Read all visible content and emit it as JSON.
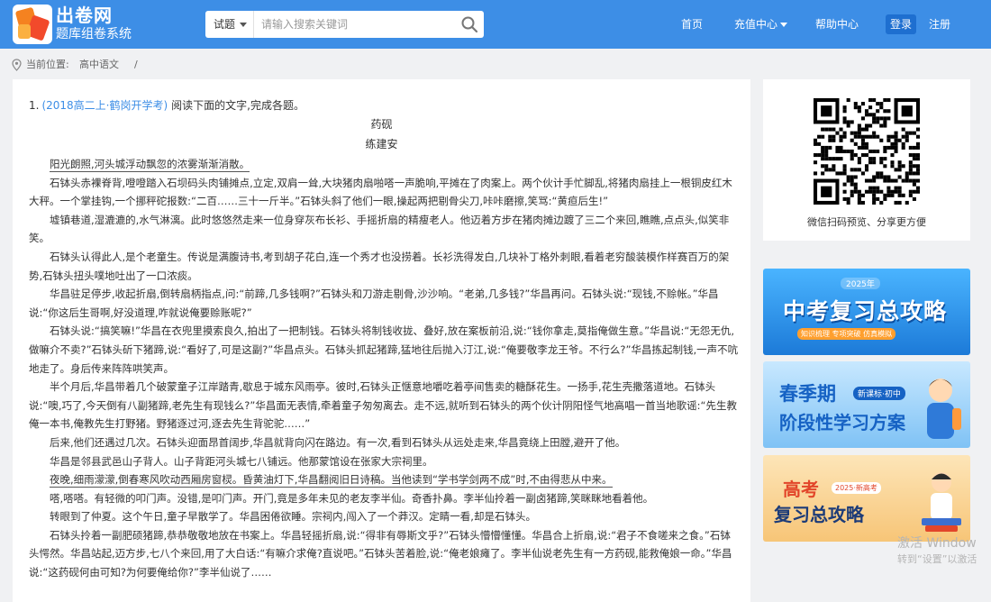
{
  "header": {
    "logo_title": "出卷网",
    "logo_subtitle": "题库组卷系统",
    "search": {
      "type_label": "试题",
      "placeholder": "请输入搜索关键词"
    },
    "nav": {
      "home": "首页",
      "charge": "充值中心",
      "help": "帮助中心",
      "login": "登录",
      "register": "注册"
    }
  },
  "breadcrumb": {
    "label": "当前位置:",
    "item": "高中语文",
    "separator": "/"
  },
  "question": {
    "number": "1.",
    "source": "(2018高二上·鹤岗开学考)",
    "instruction": "阅读下面的文字,完成各题。",
    "title": "药砚",
    "author": "练建安",
    "paragraphs": [
      "阳光朗照,河头城浮动飘忽的浓雾渐渐消散。",
      "石钵头赤裸脊背,噔噔踏入石坝码头肉铺摊点,立定,双肩一耸,大块猪肉扇啪嗒一声脆响,平摊在了肉案上。两个伙计手忙脚乱,将猪肉扇挂上一根铜皮红木大秤。一个掌挂钩,一个挪秤砣报数:“二百……三十一斤半。”石钵头斜了他们一眼,操起两把剔骨尖刀,咔咔磨擦,笑骂:“黄疸后生!”",
      "墟镇巷道,湿漉漉的,水气淋漓。此时悠悠然走来一位身穿灰布长衫、手摇折扇的精瘦老人。他迈着方步在猪肉摊边踱了三二个来回,瞧瞧,点点头,似笑非笑。",
      "石钵头认得此人,是个老童生。传说是满腹诗书,考到胡子花白,连一个秀才也没捞着。长衫洗得发白,几块补丁格外刺眼,看着老穷酸装模作样赛百万的架势,石钵头扭头噗地吐出了一口浓痰。",
      "华昌驻足停步,收起折扇,倒转扇柄指点,问:“前蹄,几多钱啊?”石钵头和刀游走剔骨,沙沙响。“老弟,几多钱?”华昌再问。石钵头说:“现钱,不赊帐。”华昌说:“你这后生哥啊,好没道理,咋就说俺要赊账呢?”",
      "石钵头说:“搞笑嘛!”华昌在衣兜里摸索良久,拍出了一把制钱。石钵头将制钱收拢、叠好,放在案板前沿,说:“钱你拿走,莫指俺做生意。”华昌说:“无怨无仇,做嘛介不卖?”石钵头斫下猪蹄,说:“看好了,可是这副?”华昌点头。石钵头抓起猪蹄,猛地往后抛入汀江,说:“俺要敬李龙王爷。不行么?”华昌拣起制钱,一声不吭地走了。身后传来阵阵哄笑声。",
      "半个月后,华昌带着几个破蒙童子江岸踏青,歇息于城东风雨亭。彼时,石钵头正惬意地嚼吃着亭间售卖的糖酥花生。一扬手,花生壳撒落道地。石钵头说:“噢,巧了,今天倒有八副猪蹄,老先生有现钱么?”华昌面无表情,牵着童子匆匆离去。走不远,就听到石钵头的两个伙计阴阳怪气地高唱一首当地歌谣:“先生教俺一本书,俺教先生打野猪。野猪逐过河,逐去先生背驼驼……”",
      "后来,他们还遇过几次。石钵头迎面昂首阔步,华昌就背向闪在路边。有一次,看到石钵头从远处走来,华昌竟绕上田膛,避开了他。",
      "华昌是邻县武邑山子背人。山子背距河头城七八铺远。他那蒙馆设在张家大宗祠里。",
      "夜晚,细雨濛濛,倒春寒风吹动西厢房窗棂。昏黄油灯下,华昌翻阅旧日诗稿。当他读到“学书学剑两不成”时,不由得悲从中来。",
      "嗒,嗒嗒。有轻微的叩门声。没错,是叩门声。开门,竟是多年未见的老友李半仙。奇香扑鼻。李半仙拎着一副卤猪蹄,笑眯眯地看着他。",
      "转眼到了仲夏。这个午日,童子早散学了。华昌困倦欲睡。宗祠内,闯入了一个莽汉。定睛一看,却是石钵头。",
      "石钵头拎着一副肥硕猪蹄,恭恭敬敬地放在书案上。华昌轻摇折扇,说:“得非有辱斯文乎?”石钵头懵懵懂懂。华昌合上折扇,说:“君子不食嗟来之食。”石钵头愕然。华昌站起,迈方步,七八个来回,用了大白话:“有嘛介求俺?直说吧。”石钵头苦着脸,说:“俺老娘瘫了。李半仙说老先生有一方药砚,能救俺娘一命。”华昌说:“这药砚何由可知?为何要俺给你?”李半仙说了……"
    ],
    "underlined_paragraphs": [
      0,
      9
    ]
  },
  "sidebar": {
    "qr_caption": "微信扫码预览、分享更方便",
    "banners": [
      {
        "year": "2025年",
        "title": "中考复习总攻略",
        "tag": "知识梳理 专项突破 仿真模拟"
      },
      {
        "title1": "春季期",
        "badge": "新课标·初中",
        "title2": "阶段性学习方案"
      },
      {
        "title1": "高考",
        "badge": "2025·新高考",
        "title2": "复习总攻略"
      }
    ]
  },
  "watermark": {
    "line1": "激活 Window",
    "line2": "转到“设置”以激活"
  },
  "colors": {
    "header_bg": "#3d8ee6",
    "link_blue": "#3d8ee6",
    "login_bg": "#1e6fd0",
    "page_bg": "#f0f1f3"
  }
}
